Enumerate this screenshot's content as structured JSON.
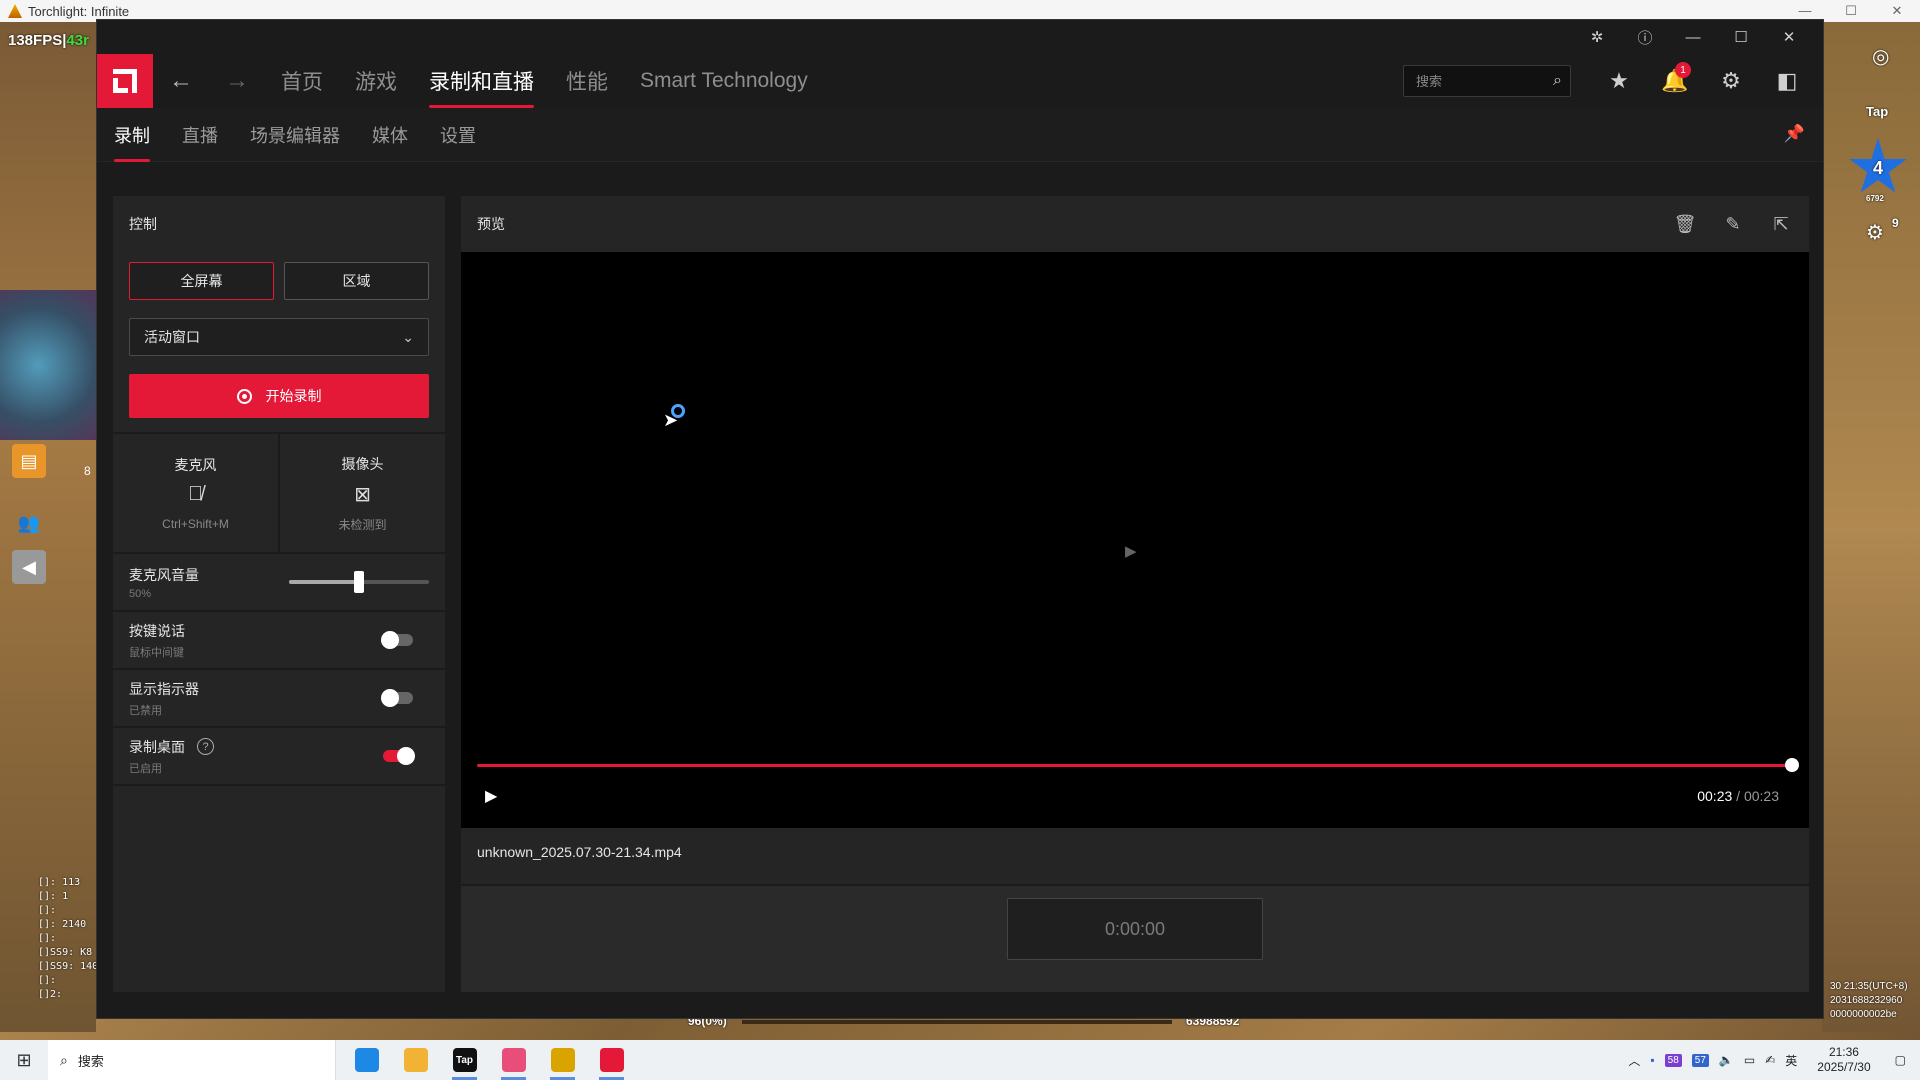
{
  "game": {
    "window_title": "Torchlight: Infinite",
    "fps": "138FPS",
    "fps_extra": "43r",
    "hud_num_8": "8",
    "right_top_label": "Tap",
    "star_level": "4",
    "star_sub": "6792",
    "right_badge": "9",
    "stats": [
      "[]: 113",
      "[]: 1",
      "[]:",
      "[]: 2140",
      "[]:",
      "[]SS9: K8",
      "[]SS9: 140",
      "[]:",
      "[]2:"
    ],
    "bottom_left_value": "96(0%)",
    "bottom_right_value": "63988592",
    "right_bottom_lines": [
      "30 21:35(UTC+8)",
      "2031688232960",
      "0000000002be"
    ]
  },
  "amd": {
    "nav": {
      "tabs": [
        "首页",
        "游戏",
        "录制和直播",
        "性能",
        "Smart Technology"
      ],
      "active_tab": 2,
      "search_placeholder": "搜索",
      "notification_count": "1"
    },
    "subnav": {
      "tabs": [
        "录制",
        "直播",
        "场景编辑器",
        "媒体",
        "设置"
      ]
    },
    "control": {
      "title": "控制",
      "fullscreen_label": "全屏幕",
      "region_label": "区域",
      "dropdown_value": "活动窗口",
      "record_label": "开始录制",
      "mic_title": "麦克风",
      "mic_shortcut": "Ctrl+Shift+M",
      "camera_title": "摄像头",
      "camera_status": "未检测到",
      "mic_volume_label": "麦克风音量",
      "mic_volume_value": "50%",
      "mic_volume_fraction": 0.5,
      "ptt_label": "按键说话",
      "ptt_sub": "鼠标中间键",
      "ptt_on": false,
      "indicator_label": "显示指示器",
      "indicator_sub": "已禁用",
      "indicator_on": false,
      "desktop_label": "录制桌面",
      "desktop_sub": "已启用",
      "desktop_on": true
    },
    "preview": {
      "title": "预览",
      "current_time": "00:23",
      "total_time": "/ 00:23",
      "progress_fraction": 1.0,
      "filename": "unknown_2025.07.30-21.34.mp4",
      "timecode": "0:00:00"
    }
  },
  "taskbar": {
    "search_label": "搜索",
    "apps": [
      {
        "name": "edge",
        "color": "#1e88e5",
        "text": ""
      },
      {
        "name": "file-explorer",
        "color": "#f2b233",
        "text": ""
      },
      {
        "name": "tap",
        "color": "#111111",
        "text": "Tap"
      },
      {
        "name": "media-app",
        "color": "#e94d7a",
        "text": ""
      },
      {
        "name": "torchlight",
        "color": "#d9a400",
        "text": ""
      },
      {
        "name": "amd-software",
        "color": "#e31937",
        "text": ""
      }
    ],
    "tray_58": "58",
    "tray_57": "57",
    "ime": "英",
    "time": "21:36",
    "date": "2025/7/30"
  }
}
